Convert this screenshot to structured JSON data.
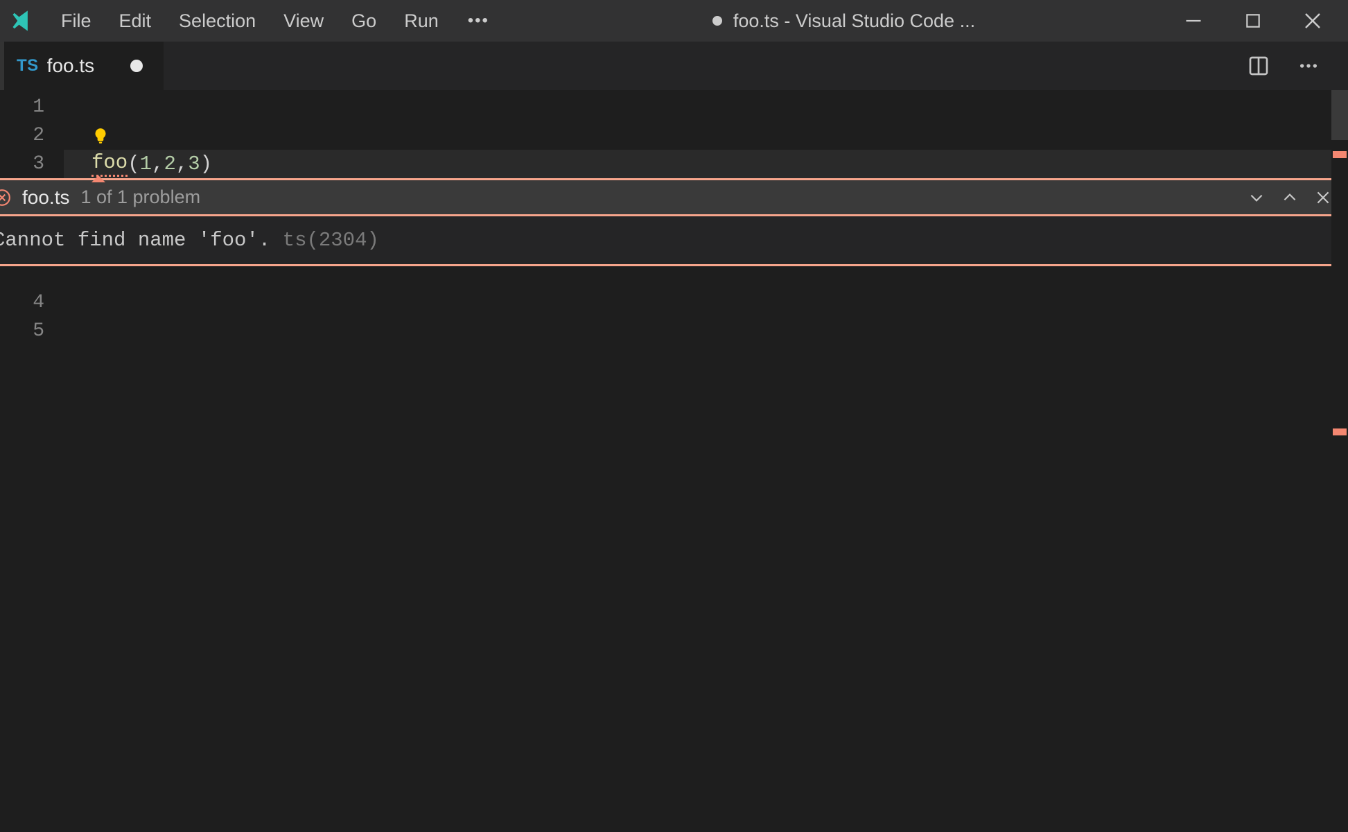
{
  "menu": {
    "file": "File",
    "edit": "Edit",
    "selection": "Selection",
    "view": "View",
    "go": "Go",
    "run": "Run"
  },
  "window": {
    "title": "foo.ts - Visual Studio Code ...",
    "dirty": true
  },
  "tab": {
    "language_badge": "TS",
    "filename": "foo.ts",
    "dirty": true
  },
  "editor": {
    "line_numbers": [
      "1",
      "2",
      "3",
      "4",
      "5"
    ],
    "code_line3": {
      "fn": "foo",
      "open": "(",
      "a1": "1",
      "c1": ", ",
      "a2": "2",
      "c2": ", ",
      "a3": "3",
      "close": ")"
    }
  },
  "peek": {
    "filename": "foo.ts",
    "count_label": "1 of 1 problem",
    "message": "Cannot find name 'foo'.",
    "error_code": "ts(2304)"
  }
}
